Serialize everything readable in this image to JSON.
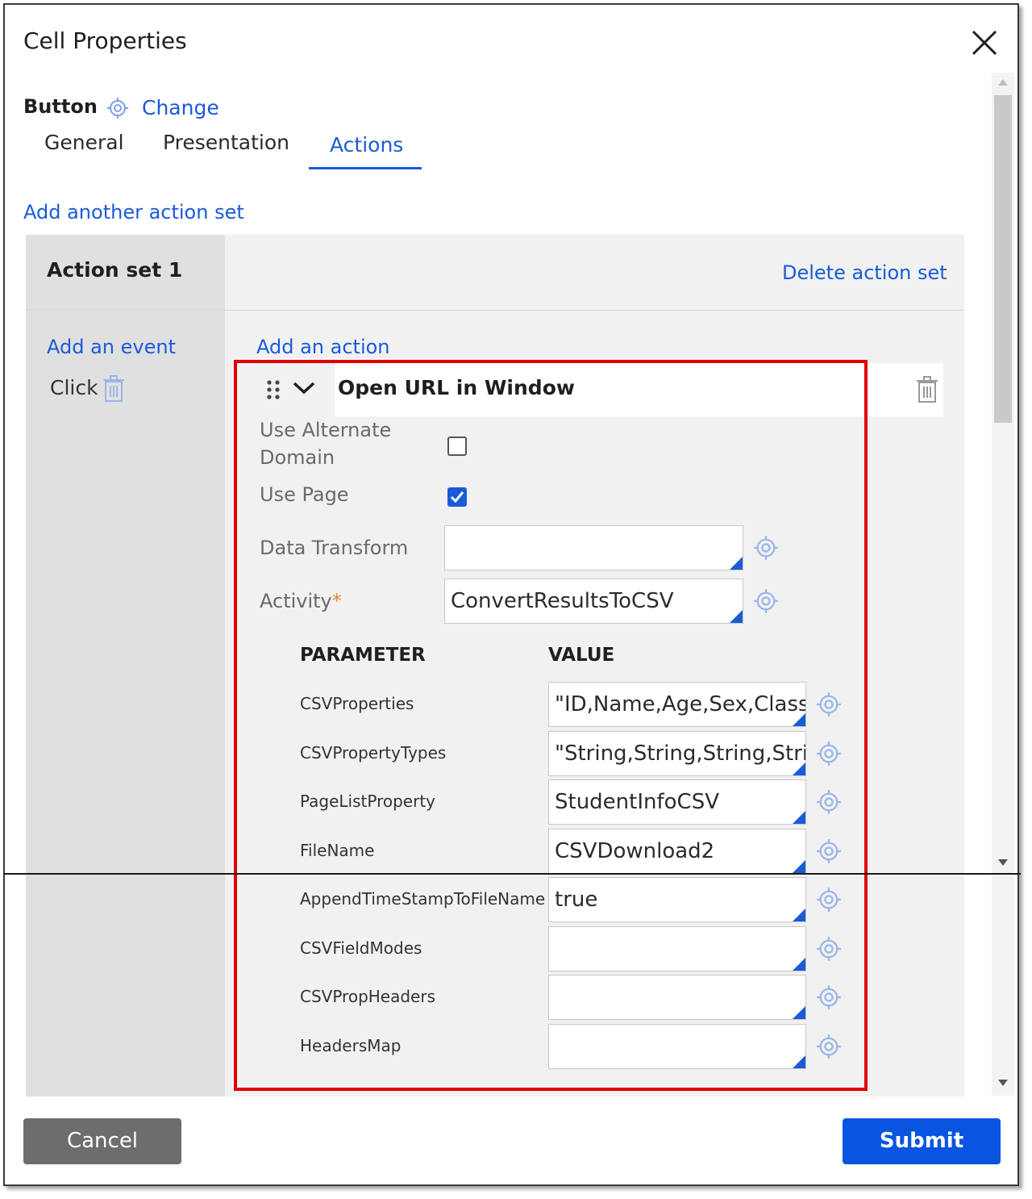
{
  "dialog": {
    "title": "Cell Properties",
    "control_type": "Button",
    "change_link": "Change"
  },
  "tabs": [
    {
      "label": "General",
      "active": false
    },
    {
      "label": "Presentation",
      "active": false
    },
    {
      "label": "Actions",
      "active": true
    }
  ],
  "actions_tab": {
    "add_action_set_link": "Add another action set",
    "action_set": {
      "title": "Action set 1",
      "delete_link": "Delete action set",
      "add_event_link": "Add an event",
      "add_action_link": "Add an action",
      "events": [
        {
          "label": "Click"
        }
      ],
      "action": {
        "title": "Open URL in Window",
        "fields": {
          "use_alternate_domain": {
            "label_line1": "Use Alternate",
            "label_line2": "Domain",
            "checked": false
          },
          "use_page": {
            "label": "Use Page",
            "checked": true
          },
          "data_transform": {
            "label": "Data Transform",
            "value": ""
          },
          "activity": {
            "label": "Activity",
            "required_mark": "*",
            "value": "ConvertResultsToCSV"
          }
        },
        "parameters_table": {
          "header_parameter": "PARAMETER",
          "header_value": "VALUE",
          "rows": [
            {
              "name": "CSVProperties",
              "value": "\"ID,Name,Age,Sex,Class,C"
            },
            {
              "name": "CSVPropertyTypes",
              "value": "\"String,String,String,String"
            },
            {
              "name": "PageListProperty",
              "value": "StudentInfoCSV"
            },
            {
              "name": "FileName",
              "value": "CSVDownload2"
            },
            {
              "name": "AppendTimeStampToFileName",
              "value": "true"
            },
            {
              "name": "CSVFieldModes",
              "value": ""
            },
            {
              "name": "CSVPropHeaders",
              "value": ""
            },
            {
              "name": "HeadersMap",
              "value": ""
            }
          ]
        }
      }
    }
  },
  "footer": {
    "cancel_label": "Cancel",
    "submit_label": "Submit"
  },
  "colors": {
    "accent": "#1a5bd6",
    "submit": "#0a55e0",
    "cancel": "#6d6d6d",
    "highlight": "#e00000",
    "required": "#e08a2b"
  },
  "icons": [
    "close-icon",
    "target-icon",
    "trash-icon",
    "drag-handle-icon",
    "chevron-down-icon",
    "checkmark-icon",
    "scroll-up-icon",
    "scroll-down-icon"
  ]
}
